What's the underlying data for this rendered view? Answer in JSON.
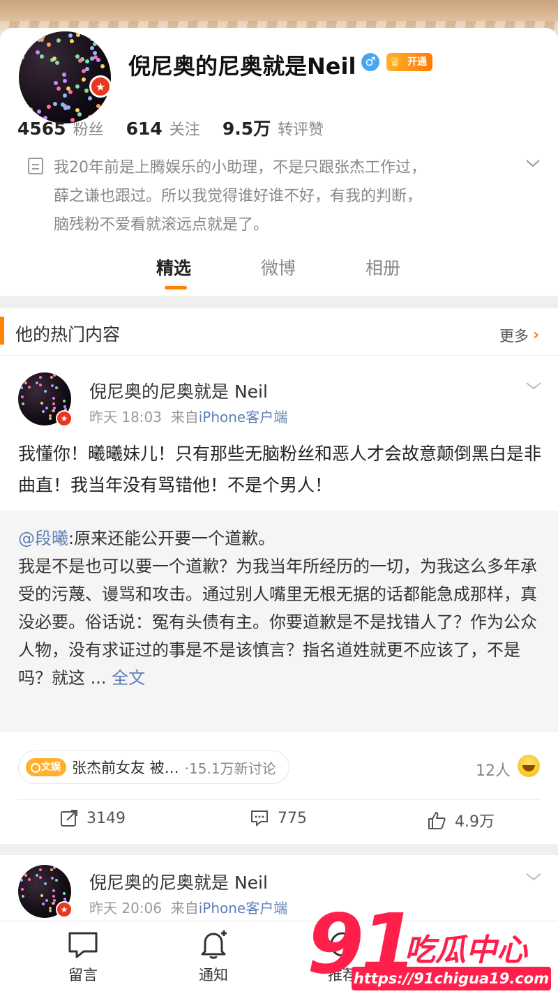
{
  "profile": {
    "username": "倪尼奥的尼奥就是Neil",
    "gender": "♂",
    "open_badge": "开通",
    "stats": [
      {
        "num": "4565",
        "label": "粉丝"
      },
      {
        "num": "614",
        "label": "关注"
      },
      {
        "num": "9.5万",
        "label": "转评赞"
      }
    ],
    "bio_lines": [
      "我20年前是上腾娱乐的小助理，不是只跟张杰工作过，",
      "薛之谦也跟过。所以我觉得谁好谁不好，有我的判断，",
      "脑残粉不爱看就滚远点就是了。"
    ]
  },
  "tabs": [
    {
      "label": "精选",
      "active": true
    },
    {
      "label": "微博",
      "active": false
    },
    {
      "label": "相册",
      "active": false
    }
  ],
  "section": {
    "title": "他的热门内容",
    "more": "更多"
  },
  "posts": [
    {
      "author": "倪尼奥的尼奥就是 Neil",
      "time": "昨天 18:03",
      "from": "来自",
      "source": "iPhone客户端",
      "text": "我懂你！曦曦妹儿！只有那些无脑粉丝和恶人才会故意颠倒黑白是非曲直！我当年没有骂错他！不是个男人！",
      "repost": {
        "mention": "@段曦",
        "line1": ":原来还能公开要一个道歉。",
        "body": "我是不是也可以要一个道歉？为我当年所经历的一切，为我这么多年承受的污蔑、谩骂和攻击。通过别人嘴里无根无据的话都能急成那样，真没必要。俗话说：冤有头债有主。你要道歉是不是找错人了？作为公众人物，没有求证过的事是不是该慎言？指名道姓就更不应该了，不是吗？就这 ...",
        "full": "全文"
      },
      "topic": {
        "tag": "文娱",
        "text": "张杰前女友 被…",
        "count": "·15.1万新讨论"
      },
      "people": "12人",
      "reposts": "3149",
      "comments": "775",
      "likes": "4.9万"
    },
    {
      "author": "倪尼奥的尼奥就是 Neil",
      "time": "昨天 20:06",
      "from": "来自",
      "source": "iPhone客户端"
    }
  ],
  "bottom_nav": [
    {
      "label": "留言"
    },
    {
      "label": "通知"
    },
    {
      "label": "推荐"
    }
  ],
  "watermark": {
    "logo_num": "91",
    "logo_text": "吃瓜中心",
    "url": "https://91chigua19.com"
  },
  "colors": {
    "accent": "#ff8200",
    "link": "#5d7fb5",
    "vip": "#e8371f",
    "watermark": "#ff1f4b"
  }
}
